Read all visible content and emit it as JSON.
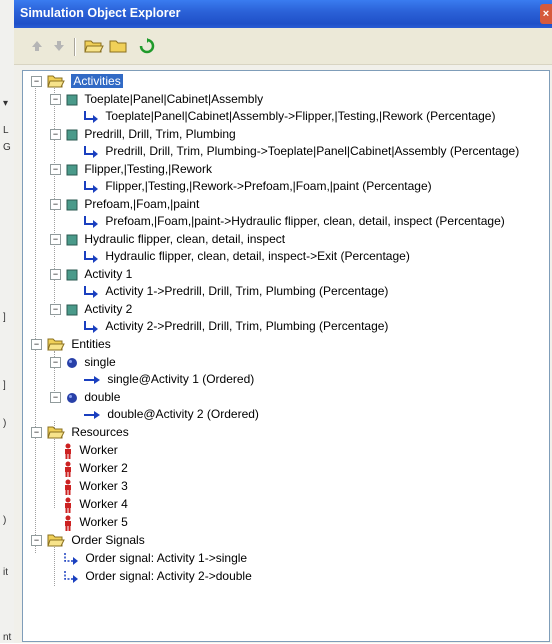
{
  "window": {
    "title": "Simulation Object Explorer",
    "close_label": "×"
  },
  "toolbar": {
    "buttons": [
      "move-up",
      "move-down",
      "open-folder",
      "new-folder",
      "refresh"
    ]
  },
  "tree": {
    "activities": {
      "label": "Activities",
      "items": [
        {
          "label": "Toeplate|Panel|Cabinet|Assembly",
          "route": "Toeplate|Panel|Cabinet|Assembly->Flipper,|Testing,|Rework (Percentage)"
        },
        {
          "label": "Predrill, Drill, Trim, Plumbing",
          "route": "Predrill, Drill, Trim, Plumbing->Toeplate|Panel|Cabinet|Assembly (Percentage)"
        },
        {
          "label": "Flipper,|Testing,|Rework",
          "route": "Flipper,|Testing,|Rework->Prefoam,|Foam,|paint (Percentage)"
        },
        {
          "label": "Prefoam,|Foam,|paint",
          "route": "Prefoam,|Foam,|paint->Hydraulic flipper, clean, detail, inspect (Percentage)"
        },
        {
          "label": "Hydraulic flipper, clean, detail, inspect",
          "route": "Hydraulic flipper, clean, detail, inspect->Exit (Percentage)"
        },
        {
          "label": "Activity 1",
          "route": "Activity 1->Predrill, Drill, Trim, Plumbing (Percentage)"
        },
        {
          "label": "Activity 2",
          "route": "Activity 2->Predrill, Drill, Trim, Plumbing (Percentage)"
        }
      ]
    },
    "entities": {
      "label": "Entities",
      "items": [
        {
          "label": "single",
          "route": "single@Activity 1 (Ordered)"
        },
        {
          "label": "double",
          "route": "double@Activity 2 (Ordered)"
        }
      ]
    },
    "resources": {
      "label": "Resources",
      "items": [
        "Worker",
        "Worker 2",
        "Worker 3",
        "Worker 4",
        "Worker 5"
      ]
    },
    "order_signals": {
      "label": "Order Signals",
      "items": [
        "Order signal: Activity 1->single",
        "Order signal: Activity 2->double"
      ]
    }
  },
  "colors": {
    "titlebar": "#2b62d8",
    "selection": "#316ac5",
    "folder": "#f0d058",
    "activity_box": "#4a9a8a",
    "entity_dot": "#2840a8",
    "route_arrow": "#1a3fbf",
    "worker": "#cc2222"
  }
}
